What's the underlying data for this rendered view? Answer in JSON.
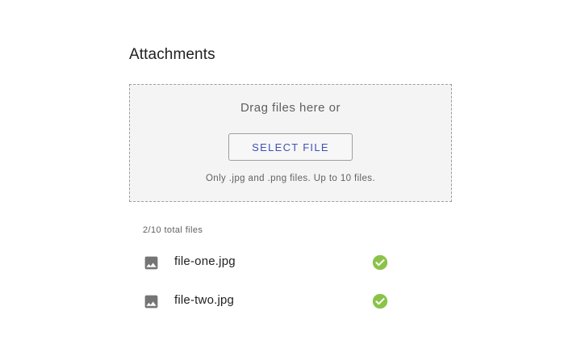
{
  "header": {
    "title": "Attachments"
  },
  "dropzone": {
    "prompt": "Drag files here or",
    "button_label": "SELECT FILE",
    "hint": "Only .jpg and .png files. Up to 10 files."
  },
  "file_list": {
    "count_label": "2/10 total files",
    "items": [
      {
        "name": "file-one.jpg",
        "icon": "image-icon",
        "status": "uploaded",
        "status_icon": "check-circle-icon"
      },
      {
        "name": "file-two.jpg",
        "icon": "image-icon",
        "status": "uploaded",
        "status_icon": "check-circle-icon"
      }
    ]
  },
  "colors": {
    "accent": "#3f51b5",
    "success": "#8bc34a",
    "icon_gray": "#757575"
  }
}
